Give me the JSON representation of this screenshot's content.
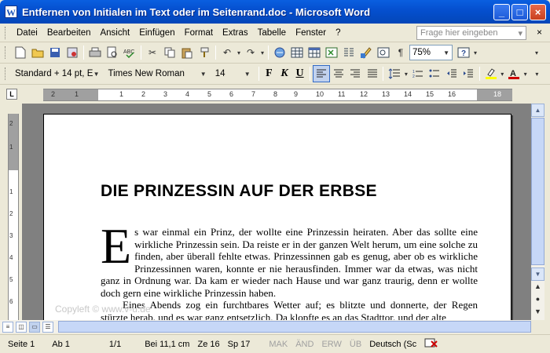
{
  "window": {
    "title": "Entfernen von Initialen im Text oder im Seitenrand.doc - Microsoft Word",
    "app_icon": "W"
  },
  "menu": {
    "items": [
      "Datei",
      "Bearbeiten",
      "Ansicht",
      "Einfügen",
      "Format",
      "Extras",
      "Tabelle",
      "Fenster",
      "?"
    ],
    "help_placeholder": "Frage hier eingeben",
    "close": "×"
  },
  "toolbar": {
    "zoom": "75%"
  },
  "format": {
    "style": "Standard + 14 pt, E",
    "font": "Times New Roman",
    "size": "14",
    "bold": "F",
    "italic": "K",
    "underline": "U"
  },
  "ruler": {
    "corner": "L",
    "h_ticks": [
      "2",
      "1",
      "1",
      "2",
      "3",
      "4",
      "5",
      "6",
      "7",
      "8",
      "9",
      "10",
      "11",
      "12",
      "13",
      "14",
      "15",
      "16",
      "18"
    ],
    "v_ticks": [
      "2",
      "1",
      "1",
      "2",
      "3",
      "4",
      "5",
      "6"
    ]
  },
  "document": {
    "title": "DIE PRINZESSIN AUF DER ERBSE",
    "dropcap": "E",
    "para1": "s war einmal ein Prinz, der wollte eine Prinzessin heiraten. Aber das sollte eine wirkliche Prinzessin sein. Da reiste er in der ganzen Welt herum, um eine solche zu finden, aber überall fehlte etwas. Prinzessinnen gab es genug, aber ob es wirkliche Prinzessinnen waren, konnte er nie herausfinden. Immer war da etwas, was nicht ganz in Ordnung war. Da kam er wieder nach Hause und war ganz traurig, denn er wollte doch gern eine wirkliche Prinzessin haben.",
    "para2": "Eines Abends zog ein furchtbares Wetter auf; es blitzte und donnerte, der Regen stürzte herab, und es war ganz entsetzlich. Da klopfte es an das Stadttor, und der alte",
    "watermark": "Copyleft © www.v-u.de"
  },
  "status": {
    "seite": "Seite  1",
    "ab": "Ab  1",
    "pages": "1/1",
    "bei": "Bei  11,1 cm",
    "ze": "Ze  16",
    "sp": "Sp  17",
    "mak": "MAK",
    "aend": "ÄND",
    "erw": "ERW",
    "ueb": "ÜB",
    "lang": "Deutsch (Sc"
  },
  "colors": {
    "titlebar": "#0550d0",
    "page": "#ffffff",
    "workspace": "#808080"
  }
}
